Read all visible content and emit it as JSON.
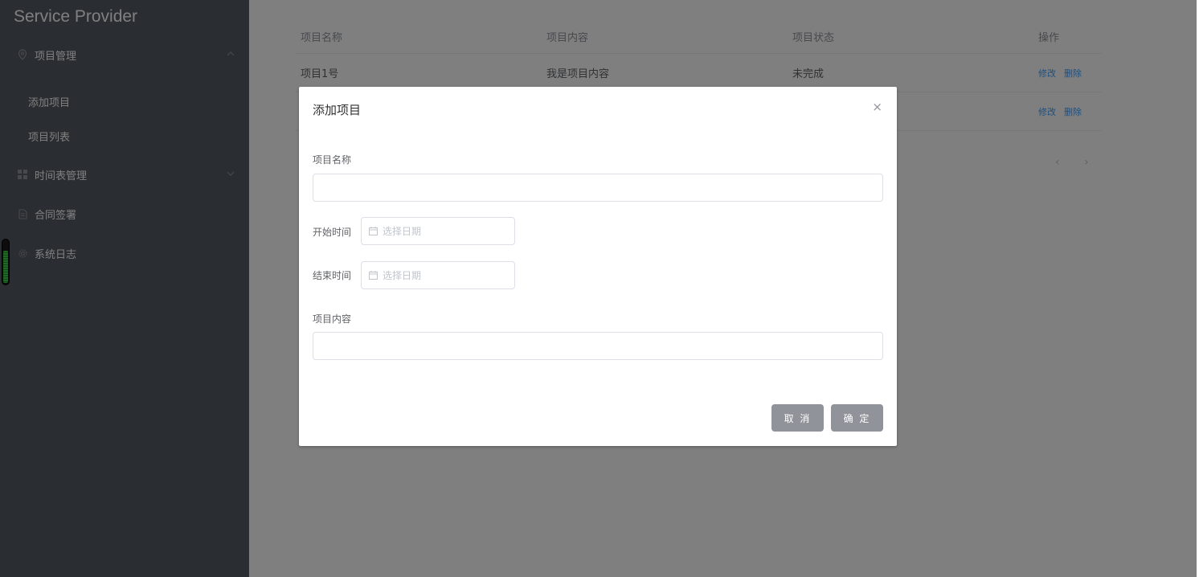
{
  "app": {
    "title": "Service Provider"
  },
  "sidebar": {
    "menus": [
      {
        "label": "项目管理",
        "icon": "location-icon",
        "expanded": true,
        "children": [
          {
            "label": "添加项目"
          },
          {
            "label": "项目列表"
          }
        ]
      },
      {
        "label": "时间表管理",
        "icon": "grid-icon",
        "expanded": false
      },
      {
        "label": "合同签署",
        "icon": "document-icon"
      },
      {
        "label": "系统日志",
        "icon": "gear-icon"
      }
    ]
  },
  "table": {
    "columns": [
      "项目名称",
      "项目内容",
      "项目状态",
      "操作"
    ],
    "rows": [
      {
        "name": "项目1号",
        "content": "我是项目内容",
        "status": "未完成",
        "actions": [
          "修改",
          "删除"
        ]
      },
      {
        "name": "",
        "content": "",
        "status": "",
        "actions": [
          "修改",
          "删除"
        ]
      }
    ],
    "pager": {
      "prev": "‹",
      "next": "›"
    }
  },
  "dialog": {
    "title": "添加项目",
    "close": "×",
    "fields": {
      "name_label": "项目名称",
      "name_value": "",
      "start_label": "开始时间",
      "start_placeholder": "选择日期",
      "end_label": "结束时间",
      "end_placeholder": "选择日期",
      "content_label": "项目内容",
      "content_value": ""
    },
    "buttons": {
      "cancel": "取 消",
      "confirm": "确 定"
    }
  },
  "colors": {
    "sidebar": "#545c64",
    "link": "#409eff",
    "button": "#909399",
    "overlay": "rgba(0,0,0,0.5)"
  }
}
